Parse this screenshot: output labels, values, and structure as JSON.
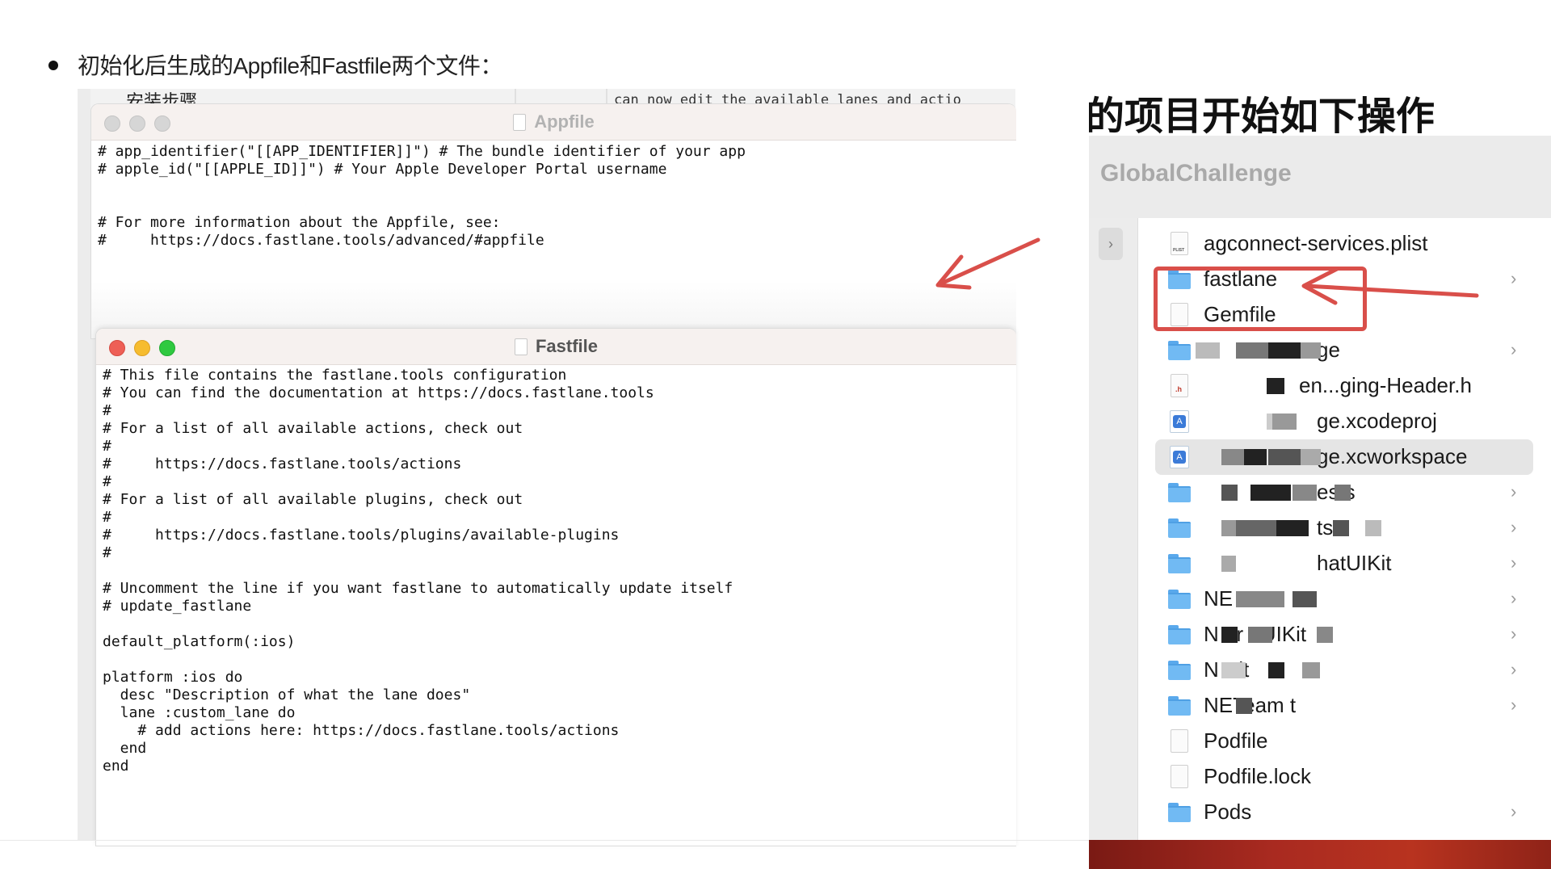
{
  "slide": {
    "bullet_text": "初始化后生成的Appfile和Fastfile两个文件：",
    "behind_window": {
      "left_text": "安装步骤",
      "right_text": "can now edit the available lanes and actio"
    }
  },
  "appfile_window": {
    "title": "Appfile",
    "code": "# app_identifier(\"[[APP_IDENTIFIER]]\") # The bundle identifier of your app\n# apple_id(\"[[APPLE_ID]]\") # Your Apple Developer Portal username\n\n\n# For more information about the Appfile, see:\n#     https://docs.fastlane.tools/advanced/#appfile"
  },
  "fastfile_window": {
    "title": "Fastfile",
    "code": "# This file contains the fastlane.tools configuration\n# You can find the documentation at https://docs.fastlane.tools\n#\n# For a list of all available actions, check out\n#\n#     https://docs.fastlane.tools/actions\n#\n# For a list of all available plugins, check out\n#\n#     https://docs.fastlane.tools/plugins/available-plugins\n#\n\n# Uncomment the line if you want fastlane to automatically update itself\n# update_fastlane\n\ndefault_platform(:ios)\n\nplatform :ios do\n  desc \"Description of what the lane does\"\n  lane :custom_lane do\n    # add actions here: https://docs.fastlane.tools/actions\n  end\nend"
  },
  "finder": {
    "heading": "的项目开始如下操作",
    "window_title": "GlobalChallenge",
    "back_icon": "chevron-left-icon",
    "files": [
      {
        "name": "agconnect-services.plist",
        "icon": "plist-file-icon",
        "folder": false
      },
      {
        "name": "fastlane",
        "icon": "folder-icon",
        "folder": true
      },
      {
        "name": "Gemfile",
        "icon": "document-icon",
        "folder": false
      },
      {
        "name": "ge",
        "icon": "folder-icon",
        "folder": true
      },
      {
        "name": "en...ging-Header.h",
        "icon": "header-file-icon",
        "folder": false
      },
      {
        "name": "ge.xcodeproj",
        "icon": "xcodeproj-icon",
        "folder": false
      },
      {
        "name": "ge.xcworkspace",
        "icon": "xcworkspace-icon",
        "folder": false
      },
      {
        "name": "ests",
        "icon": "folder-icon",
        "folder": true
      },
      {
        "name": "ts",
        "icon": "folder-icon",
        "folder": true
      },
      {
        "name": "hatUIKit",
        "icon": "folder-icon",
        "folder": true
      },
      {
        "name": "NE actU",
        "icon": "folder-icon",
        "folder": true
      },
      {
        "name": "N er nUIKit",
        "icon": "folder-icon",
        "folder": true
      },
      {
        "name": "N Kit",
        "icon": "folder-icon",
        "folder": true
      },
      {
        "name": "NETeam t",
        "icon": "folder-icon",
        "folder": true
      },
      {
        "name": "Podfile",
        "icon": "document-icon",
        "folder": false
      },
      {
        "name": "Podfile.lock",
        "icon": "document-icon",
        "folder": false
      },
      {
        "name": "Pods",
        "icon": "folder-icon",
        "folder": true
      }
    ]
  },
  "colors": {
    "annotation_red": "#d94f4a",
    "folder_blue": "#71baf3",
    "traffic_red": "#ee5f56",
    "traffic_yellow": "#f6bc2f",
    "traffic_green": "#2fc940"
  }
}
